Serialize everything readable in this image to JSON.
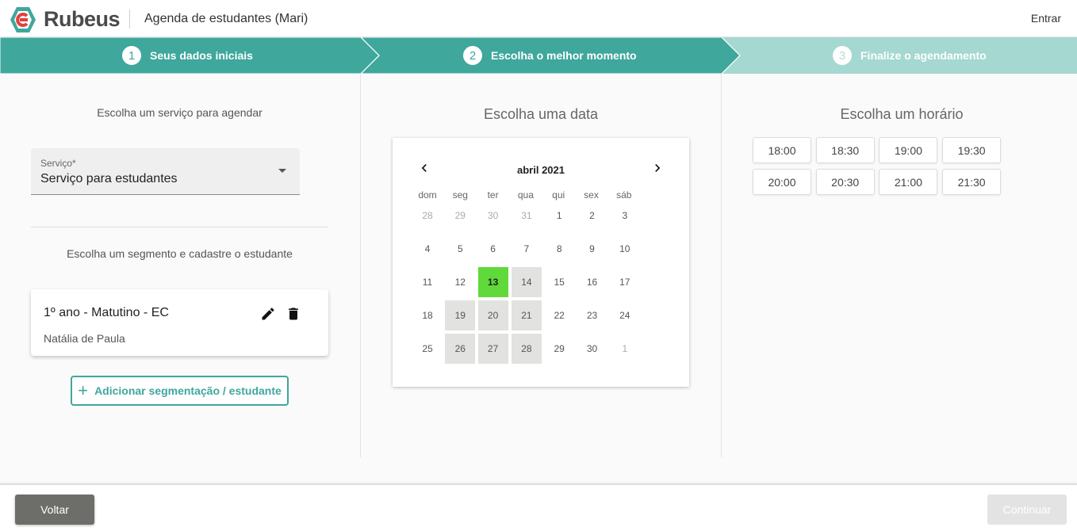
{
  "header": {
    "brand": "Rubeus",
    "title": "Agenda de estudantes (Mari)",
    "login": "Entrar"
  },
  "colors": {
    "accent": "#3fa79c",
    "step_inactive": "#a5d8d0",
    "selected_day": "#60d93a"
  },
  "stepper": [
    {
      "num": "1",
      "label": "Seus dados iniciais",
      "state": "done"
    },
    {
      "num": "2",
      "label": "Escolha o melhor momento",
      "state": "active"
    },
    {
      "num": "3",
      "label": "Finalize o agendamento",
      "state": "inactive"
    }
  ],
  "service": {
    "heading": "Escolha um serviço para agendar",
    "field_label": "Serviço*",
    "field_value": "Serviço para estudantes"
  },
  "segment": {
    "heading": "Escolha um segmento e cadastre o estudante",
    "card_title": "1º ano - Matutino - EC",
    "student": "Natália de Paula",
    "edit_icon": "pencil-icon",
    "delete_icon": "trash-icon",
    "add_button": "Adicionar segmentação / estudante"
  },
  "calendar": {
    "heading": "Escolha uma data",
    "month": "abril 2021",
    "weekdays": [
      "dom",
      "seg",
      "ter",
      "qua",
      "qui",
      "sex",
      "sáb"
    ],
    "weeks": [
      [
        "28",
        "29",
        "30",
        "31",
        "1",
        "2",
        "3"
      ],
      [
        "4",
        "5",
        "6",
        "7",
        "8",
        "9",
        "10"
      ],
      [
        "11",
        "12",
        "13",
        "14",
        "15",
        "16",
        "17"
      ],
      [
        "18",
        "19",
        "20",
        "21",
        "22",
        "23",
        "24"
      ],
      [
        "25",
        "26",
        "27",
        "28",
        "29",
        "30",
        "1"
      ]
    ],
    "selected": "13",
    "available": [
      "14",
      "19",
      "20",
      "21",
      "26",
      "27",
      "28"
    ]
  },
  "times": {
    "heading": "Escolha um horário",
    "slots": [
      "18:00",
      "18:30",
      "19:00",
      "19:30",
      "20:00",
      "20:30",
      "21:00",
      "21:30"
    ]
  },
  "footer": {
    "back": "Voltar",
    "continue": "Continuar"
  }
}
